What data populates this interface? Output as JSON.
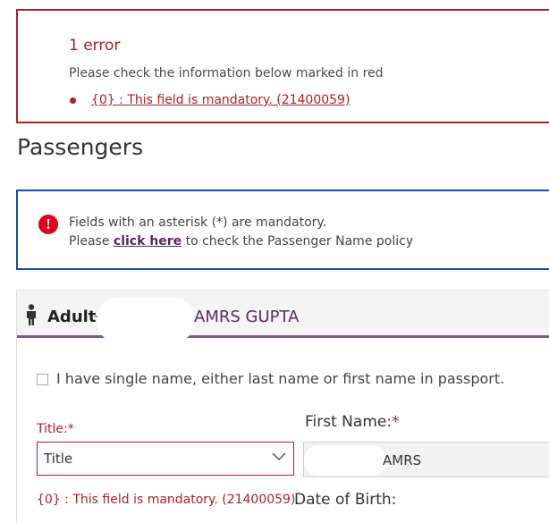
{
  "error_summary": {
    "title": "1 error",
    "description": "Please check the information below marked in red",
    "items": [
      "{0} : This field is mandatory. (21400059)"
    ]
  },
  "passengers": {
    "heading": "Passengers"
  },
  "info": {
    "line1": "Fields with an asterisk (*) are mandatory.",
    "line2_prefix": "Please ",
    "link": "click here",
    "line2_suffix": " to check the Passenger Name policy"
  },
  "passenger_card": {
    "type_label": "Adult",
    "separator": "-",
    "name": "AMRS GUPTA",
    "single_name_checkbox": {
      "label": "I have single name, either last name or first name in passport.",
      "checked": false
    },
    "title_field": {
      "label": "Title:*",
      "selected": "Title",
      "error": "{0} : This field is mandatory. (21400059)"
    },
    "first_name_field": {
      "label": "First Name:",
      "asterisk": "*",
      "value": "AMRS"
    },
    "dob_field": {
      "label": "Date of Birth:"
    }
  },
  "colors": {
    "error_red": "#a8232a",
    "info_blue": "#1a4f9c",
    "accent_purple": "#5a2a5e",
    "icon_red": "#e0001b"
  }
}
